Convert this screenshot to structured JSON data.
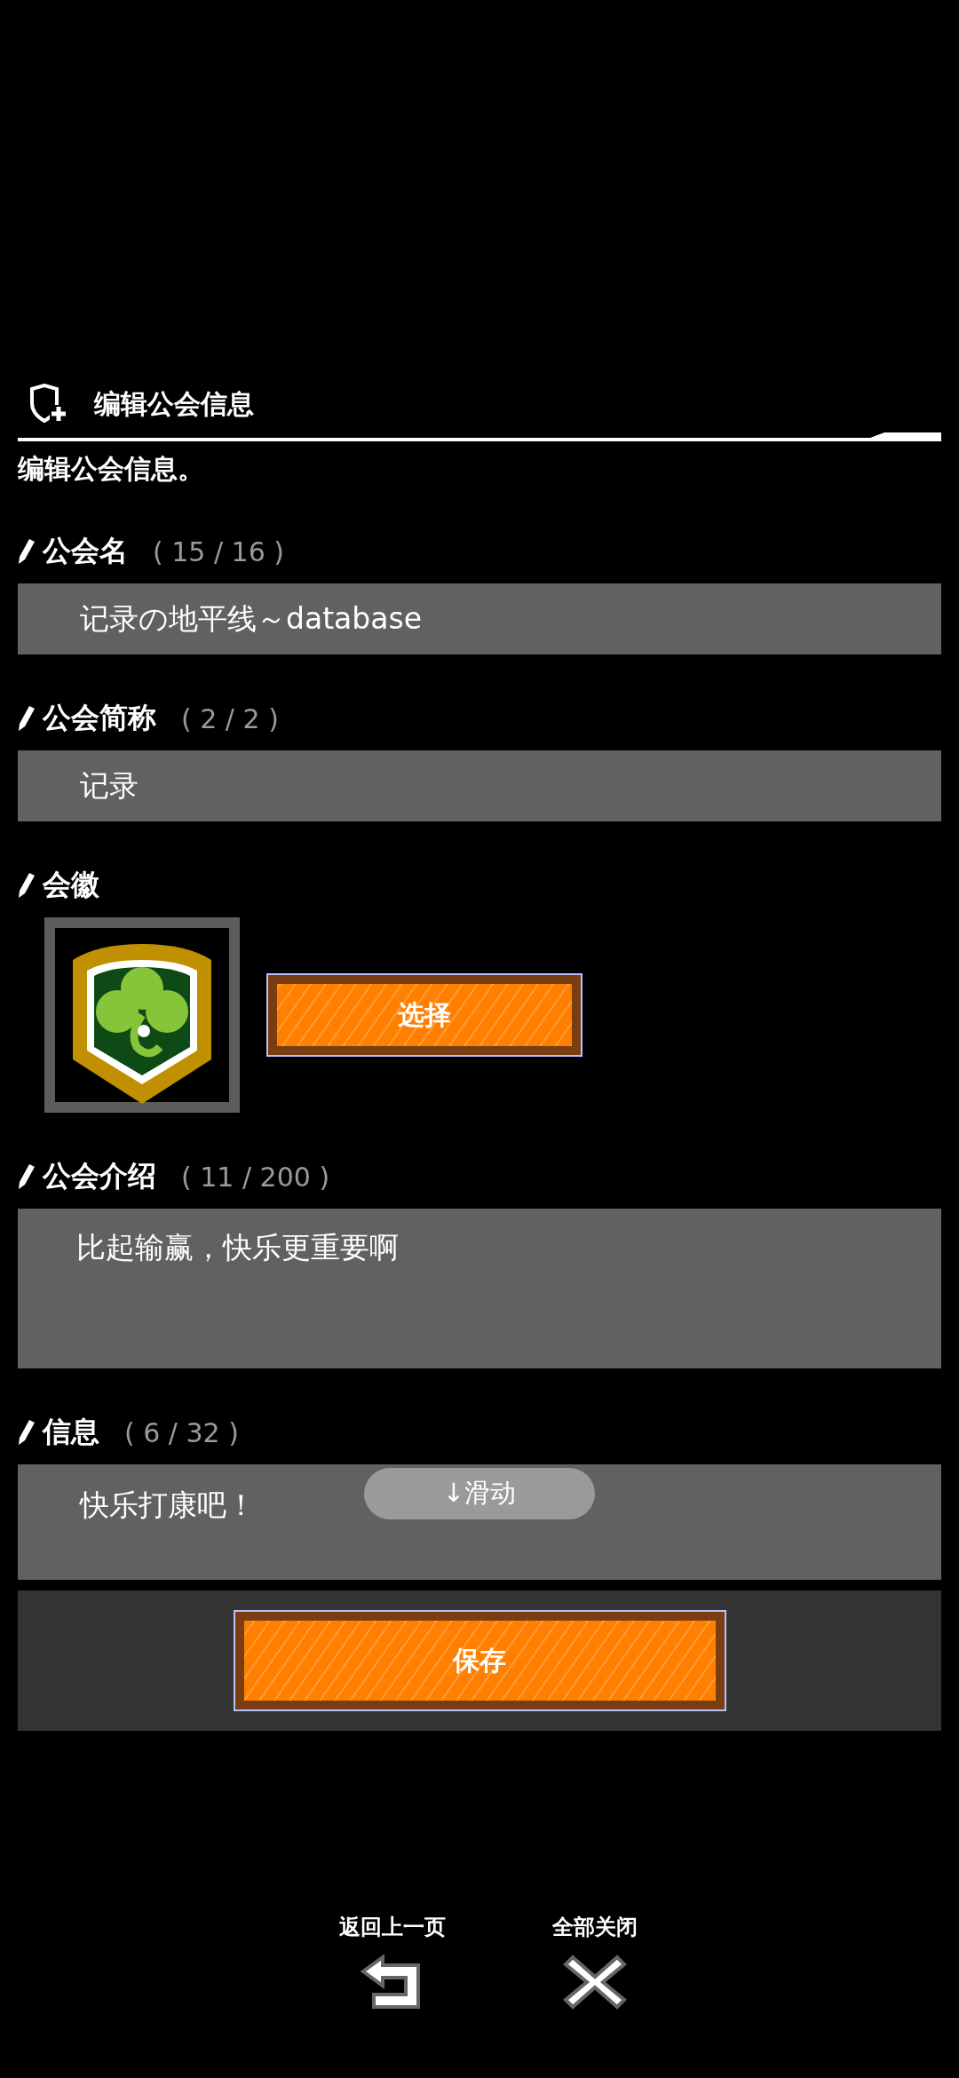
{
  "header": {
    "title": "编辑公会信息"
  },
  "description": "编辑公会信息。",
  "fields": [
    {
      "kind": "input",
      "label": "公会名",
      "count": "( 15 / 16 )",
      "value": "记录の地平线～database"
    },
    {
      "kind": "input",
      "label": "公会简称",
      "count": "( 2 / 2 )",
      "value": "记录"
    },
    {
      "kind": "emblem",
      "label": "会徽",
      "button": "选择"
    },
    {
      "kind": "textarea",
      "label": "公会介绍",
      "count": "( 11 / 200 )",
      "value": "比起输赢，快乐更重要啊"
    },
    {
      "kind": "message",
      "label": "信息",
      "count": "( 6 / 32 )",
      "value": "快乐打康吧！",
      "scroll_hint": "↓滑动"
    }
  ],
  "save_button": "保存",
  "bottom_actions": [
    {
      "kind": "back",
      "label": "返回上一页"
    },
    {
      "kind": "close",
      "label": "全部关闭"
    }
  ]
}
